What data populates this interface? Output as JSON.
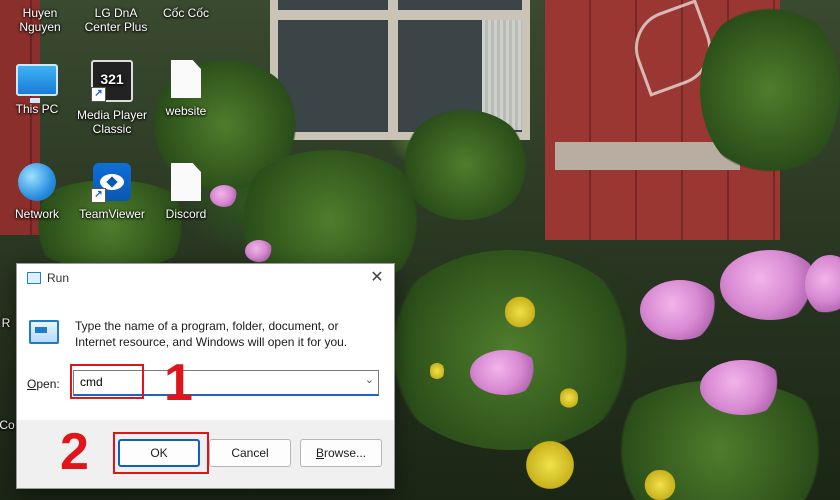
{
  "desktop": {
    "icons": [
      {
        "label": "Huyen\nNguyen",
        "icon": "user-folder-icon"
      },
      {
        "label": "LG DnA\nCenter Plus",
        "icon": "lg-app-icon"
      },
      {
        "label": "Cốc Cốc",
        "icon": "coccoc-browser-icon"
      },
      {
        "label": "This PC",
        "icon": "monitor-icon"
      },
      {
        "label": "Media Player\nClassic",
        "icon": "media-player-icon",
        "glyph_text": "321"
      },
      {
        "label": "website",
        "icon": "document-icon"
      },
      {
        "label": "Network",
        "icon": "network-globe-icon"
      },
      {
        "label": "TeamViewer",
        "icon": "teamviewer-icon"
      },
      {
        "label": "Discord",
        "icon": "document-icon"
      }
    ],
    "edge_fragments": {
      "left_r": "R",
      "left_co": "Co"
    }
  },
  "run_dialog": {
    "title": "Run",
    "close_glyph": "✕",
    "description": "Type the name of a program, folder, document, or Internet resource, and Windows will open it for you.",
    "open_label_prefix": "",
    "open_label_key": "O",
    "open_label_rest": "pen:",
    "input_value": "cmd",
    "chevron_glyph": "⌄",
    "buttons": {
      "ok": "OK",
      "cancel": "Cancel",
      "browse_key": "B",
      "browse_rest": "rowse..."
    }
  },
  "annotations": {
    "step1": "1",
    "step2": "2",
    "highlight_color": "#e0141a"
  },
  "colors": {
    "accent": "#0f5fc4",
    "annotation": "#e0141a"
  }
}
